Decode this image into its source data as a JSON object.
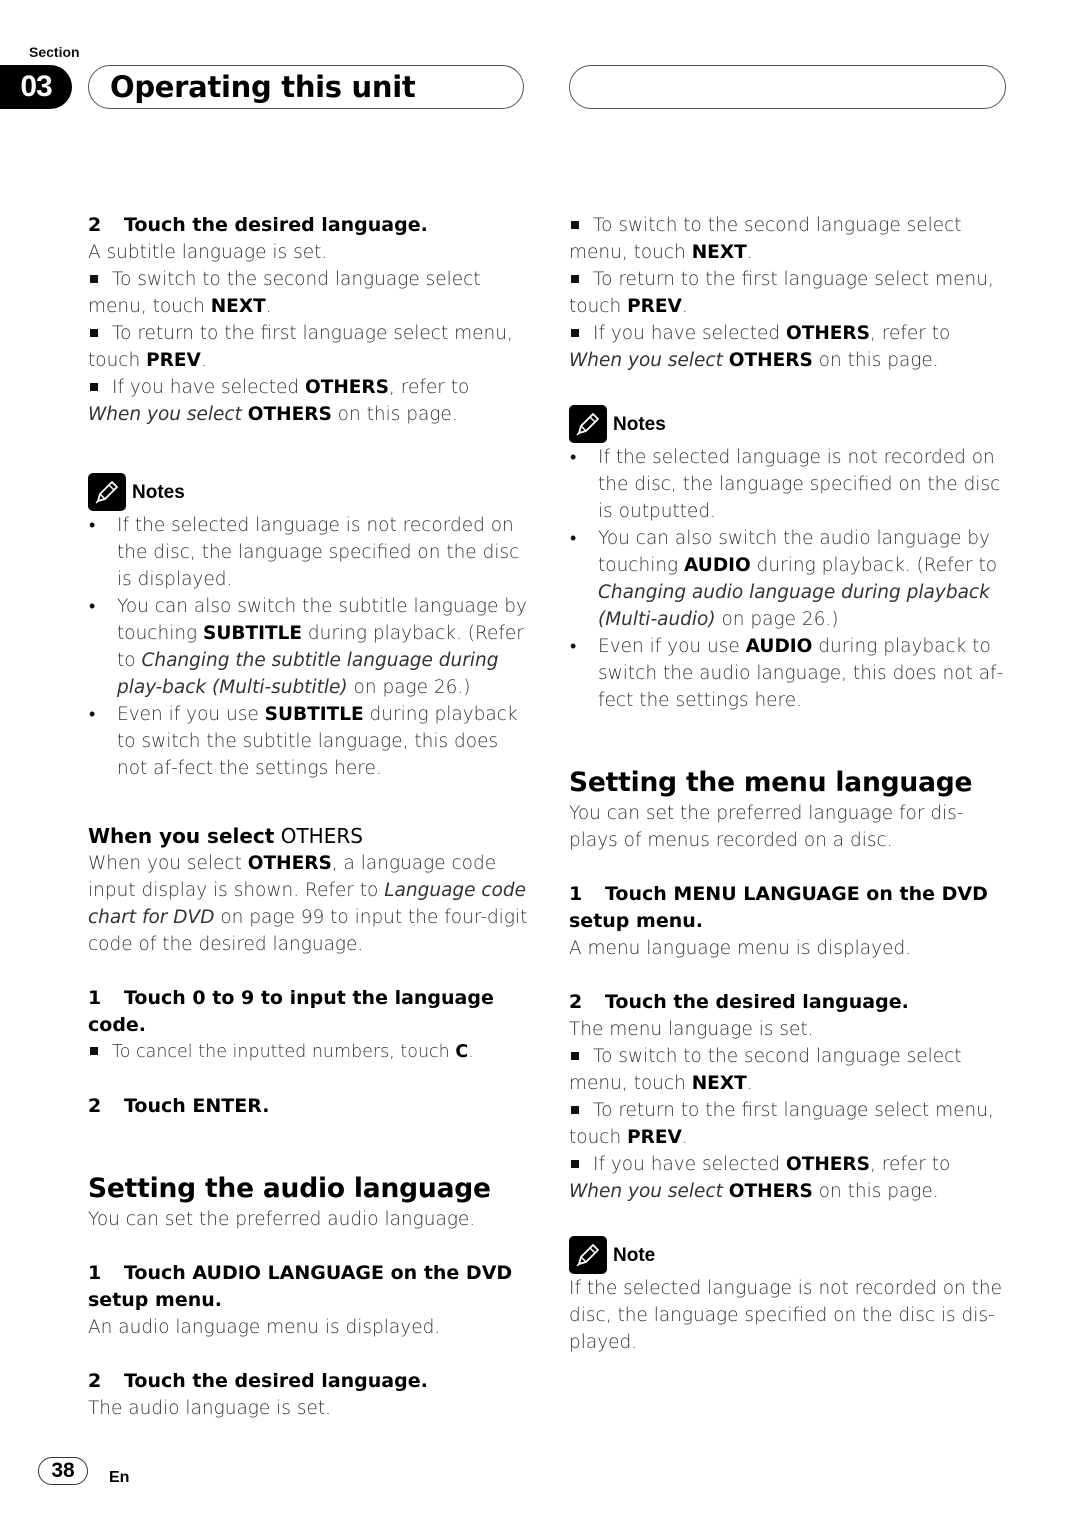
{
  "header": {
    "section_label": "Section",
    "section_number": "03",
    "title": "Operating this unit"
  },
  "left": {
    "step2": {
      "num": "2",
      "label": "Touch the desired language."
    },
    "step2_result": "A subtitle language is set.",
    "tips": [
      {
        "pre": "To switch to the second language select menu, touch ",
        "bold": "NEXT",
        "post": "."
      },
      {
        "pre": "To return to the first language select menu, touch ",
        "bold": "PREV",
        "post": "."
      }
    ],
    "others_tip": {
      "pre": "If you have selected ",
      "bold1": "OTHERS",
      "mid": ", refer to ",
      "ital": "When you select",
      "bold2": "OTHERS",
      "post": " on this page."
    },
    "notes_label": "Notes",
    "notes": [
      {
        "text": "If the selected language is not recorded on the disc, the language specified on the disc is displayed."
      },
      {
        "pre": "You can also switch the subtitle language by touching ",
        "bold": "SUBTITLE",
        "mid": " during playback. (Refer to ",
        "ital": "Changing the subtitle language during play-back (Multi-subtitle)",
        "post": " on page 26.)"
      },
      {
        "pre": "Even if you use ",
        "bold": "SUBTITLE",
        "post": " during playback to switch the subtitle language, this does not af-fect the settings here."
      }
    ],
    "others_heading": {
      "bold": "When you select",
      "thin": " OTHERS"
    },
    "others_body": {
      "pre": "When you select ",
      "bold": "OTHERS",
      "mid": ", a language code input display is shown. Refer to ",
      "ital": "Language code chart for DVD",
      "post": " on page 99 to input the four-digit code of the desired language."
    },
    "others_step1": {
      "num": "1",
      "label": "Touch 0 to 9 to input the language code."
    },
    "others_step1_tip": {
      "pre": "To cancel the inputted numbers, touch ",
      "bold": "C",
      "post": "."
    },
    "others_step2": {
      "num": "2",
      "label": "Touch ENTER."
    },
    "audio_heading": "Setting the audio language",
    "audio_intro": "You can set the preferred audio language.",
    "audio_step1": {
      "num": "1",
      "label": "Touch AUDIO LANGUAGE on the DVD setup menu."
    },
    "audio_step1_result": "An audio language menu is displayed.",
    "audio_step2": {
      "num": "2",
      "label": "Touch the desired language."
    },
    "audio_step2_result": "The audio language is set."
  },
  "right": {
    "tips": [
      {
        "pre": "To switch to the second language select menu, touch ",
        "bold": "NEXT",
        "post": "."
      },
      {
        "pre": "To return to the first language select menu, touch ",
        "bold": "PREV",
        "post": "."
      }
    ],
    "others_tip": {
      "pre": "If you have selected ",
      "bold1": "OTHERS",
      "mid": ", refer to ",
      "ital": "When you select",
      "bold2": "OTHERS",
      "post": " on this page."
    },
    "notes_label": "Notes",
    "notes": [
      {
        "text": "If the selected language is not recorded on the disc, the language specified on the disc is outputted."
      },
      {
        "pre": "You can also switch the audio language by touching ",
        "bold": "AUDIO",
        "mid": " during playback. (Refer to ",
        "ital": "Changing audio language during playback (Multi-audio)",
        "post": " on page 26.)"
      },
      {
        "pre": "Even if you use ",
        "bold": "AUDIO",
        "post": " during playback to switch the audio language, this does not af-fect the settings here."
      }
    ],
    "menu_heading": "Setting the menu language",
    "menu_intro": "You can set the preferred language for dis-plays of menus recorded on a disc.",
    "menu_step1": {
      "num": "1",
      "label": "Touch MENU LANGUAGE on the DVD setup menu."
    },
    "menu_step1_result": "A menu language menu is displayed.",
    "menu_step2": {
      "num": "2",
      "label": "Touch the desired language."
    },
    "menu_step2_result": "The menu language is set.",
    "menu_tips": [
      {
        "pre": "To switch to the second language select menu, touch ",
        "bold": "NEXT",
        "post": "."
      },
      {
        "pre": "To return to the first language select menu, touch ",
        "bold": "PREV",
        "post": "."
      }
    ],
    "menu_others_tip": {
      "pre": "If you have selected ",
      "bold1": "OTHERS",
      "mid": ", refer to ",
      "ital": "When you select",
      "bold2": "OTHERS",
      "post": " on this page."
    },
    "note_label": "Note",
    "note_text": "If the selected language is not recorded on the disc, the language specified on the disc is dis-played."
  },
  "footer": {
    "page_number": "38",
    "language": "En"
  }
}
